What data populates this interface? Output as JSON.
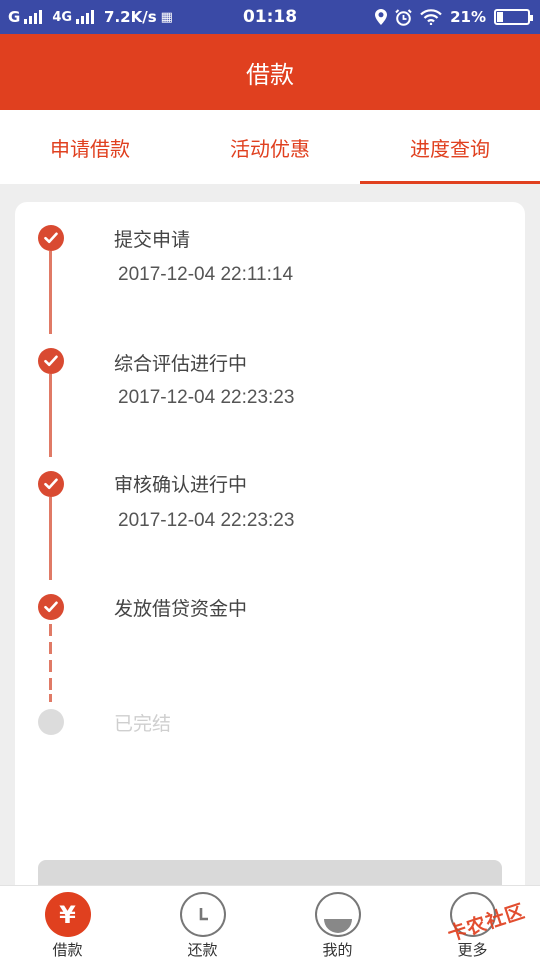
{
  "status_bar": {
    "carrier1": "G",
    "carrier2": "4G",
    "speed": "7.2K/s",
    "time": "01:18",
    "battery_percent": "21%",
    "battery_level": 0.21
  },
  "header": {
    "title": "借款"
  },
  "tabs": [
    {
      "label": "申请借款",
      "active": false
    },
    {
      "label": "活动优惠",
      "active": false
    },
    {
      "label": "进度查询",
      "active": true
    }
  ],
  "steps": [
    {
      "title": "提交申请",
      "time": "2017-12-04 22:11:14",
      "status": "done"
    },
    {
      "title": "综合评估进行中",
      "time": "2017-12-04 22:23:23",
      "status": "done"
    },
    {
      "title": "审核确认进行中",
      "time": "2017-12-04 22:23:23",
      "status": "done"
    },
    {
      "title": "发放借贷资金中",
      "time": "",
      "status": "done"
    },
    {
      "title": "已完结",
      "time": "",
      "status": "pending"
    }
  ],
  "bottom_nav": [
    {
      "label": "借款",
      "icon": "yuan-icon",
      "glyph": "¥",
      "active": true
    },
    {
      "label": "还款",
      "icon": "clock-icon",
      "active": false
    },
    {
      "label": "我的",
      "icon": "profile-icon",
      "active": false
    },
    {
      "label": "更多",
      "icon": "more-icon",
      "active": false
    }
  ],
  "watermark": "卡农社区",
  "colors": {
    "brand": "#e0401f",
    "status_bar": "#3a4aa6",
    "timeline": "#d94a31"
  }
}
